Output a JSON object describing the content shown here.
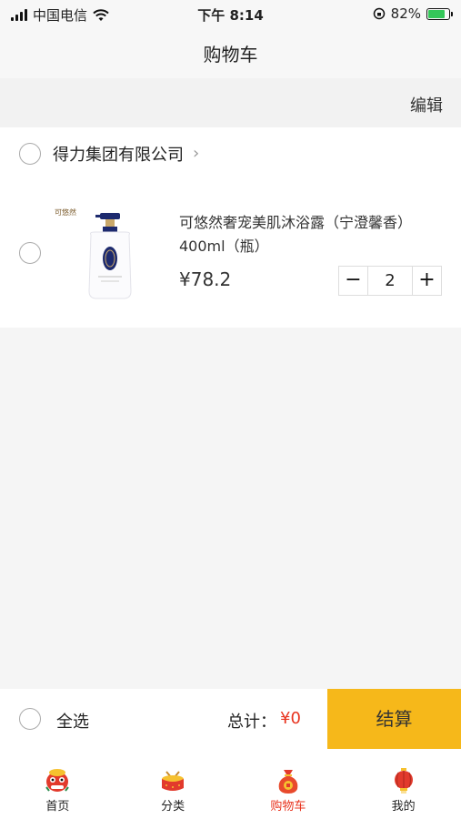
{
  "status_bar": {
    "carrier": "中国电信",
    "time": "下午 8:14",
    "battery": "82%",
    "battery_level": 0.82
  },
  "nav": {
    "title": "购物车",
    "edit_label": "编辑"
  },
  "cart": {
    "store_name": "得力集团有限公司",
    "item": {
      "name": "可悠然奢宠美肌沐浴露（宁澄馨香）400ml（瓶）",
      "price": "¥78.2",
      "quantity": "2",
      "minus": "−",
      "plus": "+",
      "image_brand": "可悠然"
    }
  },
  "checkout": {
    "select_all_label": "全选",
    "total_label": "总计：",
    "total_value": "¥0",
    "checkout_label": "结算"
  },
  "tabs": [
    {
      "label": "首页",
      "icon": "lion-dance-icon"
    },
    {
      "label": "分类",
      "icon": "drum-icon"
    },
    {
      "label": "购物车",
      "icon": "lucky-bag-icon",
      "active": true
    },
    {
      "label": "我的",
      "icon": "lantern-icon"
    }
  ],
  "colors": {
    "accent": "#e8341f",
    "checkout_button": "#f6b81a",
    "page_bg": "#f5f5f5"
  }
}
